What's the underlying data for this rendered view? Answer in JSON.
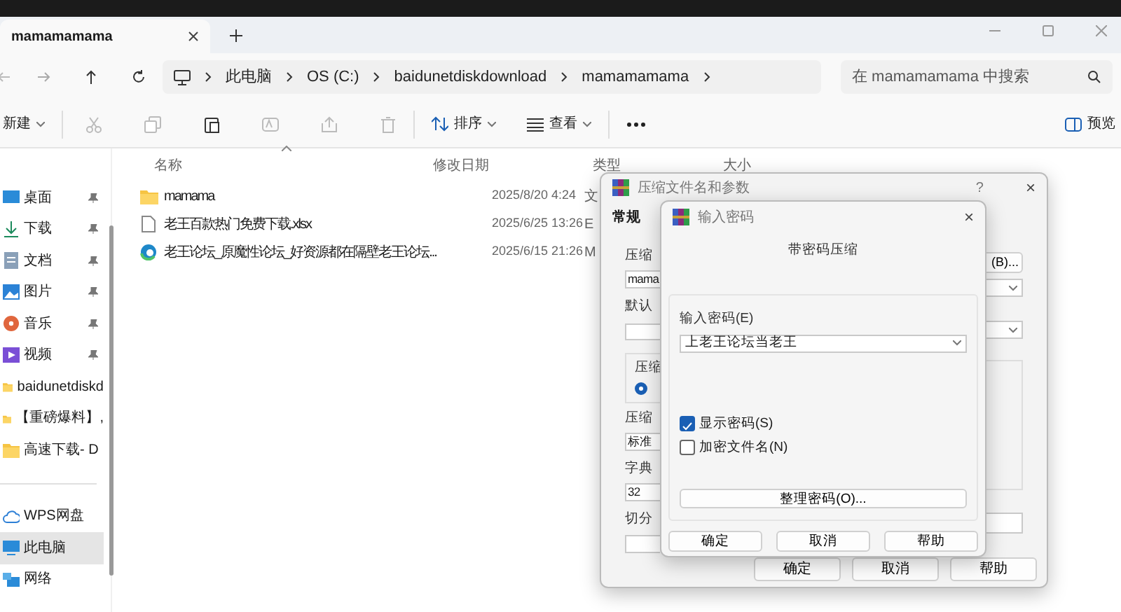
{
  "explorer": {
    "tabs": [
      {
        "label": "mamamamama",
        "selected": true
      }
    ],
    "breadcrumb": [
      "此电脑",
      "OS (C:)",
      "baidunetdiskdownload",
      "mamamamama"
    ],
    "search": {
      "placeholder": "在 mamamamama 中搜索"
    },
    "toolbar": {
      "new": "新建",
      "sort": "排序",
      "view": "查看",
      "preview": "预览"
    },
    "sidebar": [
      {
        "label": "桌面",
        "kind": "desktop",
        "pinned": true,
        "selected": false
      },
      {
        "label": "下载",
        "kind": "download",
        "pinned": true,
        "selected": false
      },
      {
        "label": "文档",
        "kind": "docs",
        "pinned": true,
        "selected": false
      },
      {
        "label": "图片",
        "kind": "pictures",
        "pinned": true,
        "selected": false
      },
      {
        "label": "音乐",
        "kind": "music",
        "pinned": true,
        "selected": false
      },
      {
        "label": "视频",
        "kind": "video",
        "pinned": true,
        "selected": false
      },
      {
        "label": "baidunetdiskd",
        "kind": "folder",
        "pinned": false,
        "selected": false
      },
      {
        "label": "【重磅爆料】, ",
        "kind": "folder",
        "pinned": false,
        "selected": false
      },
      {
        "label": "高速下载- D",
        "kind": "folder",
        "pinned": false,
        "selected": false
      },
      {
        "kind": "separator"
      },
      {
        "label": "WPS网盘",
        "kind": "cloud",
        "pinned": false,
        "selected": false
      },
      {
        "label": "此电脑",
        "kind": "pc",
        "pinned": false,
        "selected": true
      },
      {
        "label": "网络",
        "kind": "network",
        "pinned": false,
        "selected": false
      }
    ],
    "columns": [
      "名称",
      "修改日期",
      "类型",
      "大小"
    ],
    "files": [
      {
        "name": "mamama",
        "kind": "folder",
        "date": "2025/8/20 4:24",
        "type": "文"
      },
      {
        "name": "老王百款热门免费下载.xlsx",
        "kind": "file",
        "date": "2025/6/25 13:26",
        "type": "E"
      },
      {
        "name": "老王论坛_原魔性论坛_好资源都在隔壁老王论坛...",
        "kind": "web",
        "date": "2025/6/15 21:26",
        "type": "M"
      }
    ]
  },
  "archive_dialog": {
    "title": "压缩文件名和参数",
    "help": "?",
    "close": "×",
    "tabs": [
      {
        "label": "常规",
        "selected": true
      }
    ],
    "left_labels": [
      "压缩",
      "默认",
      "压缩",
      "字典",
      "切分"
    ],
    "archive_name": "mama",
    "group_label": "压缩",
    "radio_checked": true,
    "method": "标准",
    "dictionary": "32",
    "browse_button": "(B)...",
    "buttons": [
      "确定",
      "取消",
      "帮助"
    ]
  },
  "password_dialog": {
    "title": "输入密码",
    "close": "×",
    "heading": "带密码压缩",
    "label": "输入密码(E)",
    "value": "上老王论坛当老王",
    "options": [
      {
        "label": "显示密码(S)",
        "checked": true
      },
      {
        "label": "加密文件名(N)",
        "checked": false
      }
    ],
    "organize_button": "整理密码(O)...",
    "buttons": [
      "确定",
      "取消",
      "帮助"
    ]
  }
}
